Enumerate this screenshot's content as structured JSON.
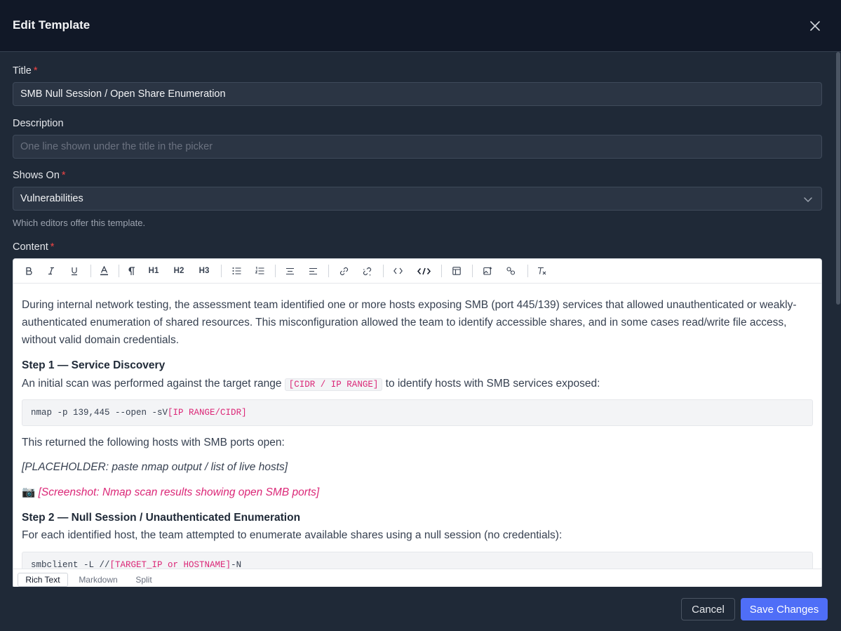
{
  "header": {
    "title": "Edit Template"
  },
  "form": {
    "title_label": "Title",
    "title_value": "SMB Null Session / Open Share Enumeration",
    "description_label": "Description",
    "description_placeholder": "One line shown under the title in the picker",
    "shows_on_label": "Shows On",
    "shows_on_value": "Vulnerabilities",
    "shows_on_hint": "Which editors offer this template.",
    "content_label": "Content",
    "required_mark": "*"
  },
  "toolbar": {
    "items": [
      "bold-icon",
      "italic-icon",
      "underline-icon",
      "text-color-icon",
      "paragraph-icon",
      "H1",
      "H2",
      "H3",
      "bullet-list-icon",
      "ordered-list-icon",
      "align-center-icon",
      "align-left-icon",
      "link-icon",
      "unlink-icon",
      "inline-code-icon",
      "code-block-icon",
      "table-icon",
      "image-icon",
      "image-link-icon",
      "clear-format-icon"
    ]
  },
  "content": {
    "intro": "During internal network testing, the assessment team identified one or more hosts exposing SMB (port 445/139) services that allowed unauthenticated or weakly-authenticated enumeration of shared resources. This misconfiguration allowed the team to identify accessible shares, and in some cases read/write file access, without valid domain credentials.",
    "step1_heading": "Step 1 — Service Discovery",
    "step1_text_before": "An initial scan was performed against the target range ",
    "step1_inline_code": "[CIDR / IP RANGE]",
    "step1_text_after": " to identify hosts with SMB services exposed:",
    "step1_code_cmd": "nmap -p 139,445 --open -sV ",
    "step1_code_placeholder": "[IP RANGE/CIDR]",
    "step1_returned": "This returned the following hosts with SMB ports open:",
    "step1_placeholder": "[PLACEHOLDER: paste nmap output / list of live hosts]",
    "step1_camera": "📷",
    "step1_screenshot": "[Screenshot: Nmap scan results showing open SMB ports]",
    "step2_heading": "Step 2 — Null Session / Unauthenticated Enumeration",
    "step2_text": "For each identified host, the team attempted to enumerate available shares using a null session (no credentials):",
    "step2_code_before": "smbclient -L //",
    "step2_code_placeholder": "[TARGET_IP or HOSTNAME]",
    "step2_code_after": " -N"
  },
  "modes": {
    "rich": "Rich Text",
    "markdown": "Markdown",
    "split": "Split",
    "active": "Rich Text"
  },
  "footer": {
    "cancel": "Cancel",
    "save": "Save Changes"
  },
  "colors": {
    "accent": "#4f6ef7",
    "required": "#ef4444",
    "placeholder_code": "#db2777"
  }
}
